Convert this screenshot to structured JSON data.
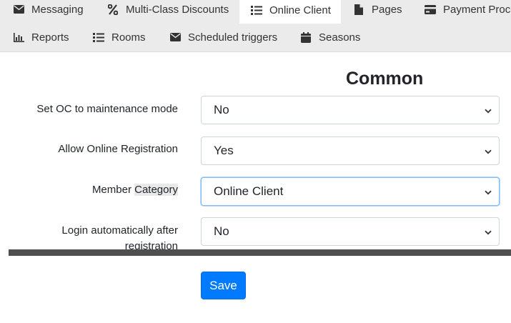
{
  "tabs_row1": [
    {
      "label": "Messaging",
      "icon": "envelope-icon",
      "active": false
    },
    {
      "label": "Multi-Class Discounts",
      "icon": "percent-icon",
      "active": false
    },
    {
      "label": "Online Client",
      "icon": "list-icon",
      "active": true
    },
    {
      "label": "Pages",
      "icon": "file-icon",
      "active": false
    },
    {
      "label": "Payment Proce",
      "icon": "credit-card-icon",
      "active": false
    }
  ],
  "tabs_row2": [
    {
      "label": "Reports",
      "icon": "bar-chart-icon",
      "active": false
    },
    {
      "label": "Rooms",
      "icon": "list-icon",
      "active": false
    },
    {
      "label": "Scheduled triggers",
      "icon": "envelope-icon",
      "active": false
    },
    {
      "label": "Seasons",
      "icon": "calendar-icon",
      "active": false
    }
  ],
  "section": {
    "title": "Common"
  },
  "fields": {
    "maintenance": {
      "label": "Set OC to maintenance mode",
      "value": "No"
    },
    "online_registration": {
      "label": "Allow Online Registration",
      "value": "Yes"
    },
    "member_category": {
      "label_prefix": "Member ",
      "label_highlight": "Category",
      "value": "Online Client"
    },
    "auto_login": {
      "label_line1": "Login automatically after",
      "label_line2": "registration",
      "value": "No"
    }
  },
  "actions": {
    "save_label": "Save"
  },
  "colors": {
    "accent": "#007bff",
    "tabbar_bg": "#ebebeb",
    "focus_border": "#80bdff"
  }
}
